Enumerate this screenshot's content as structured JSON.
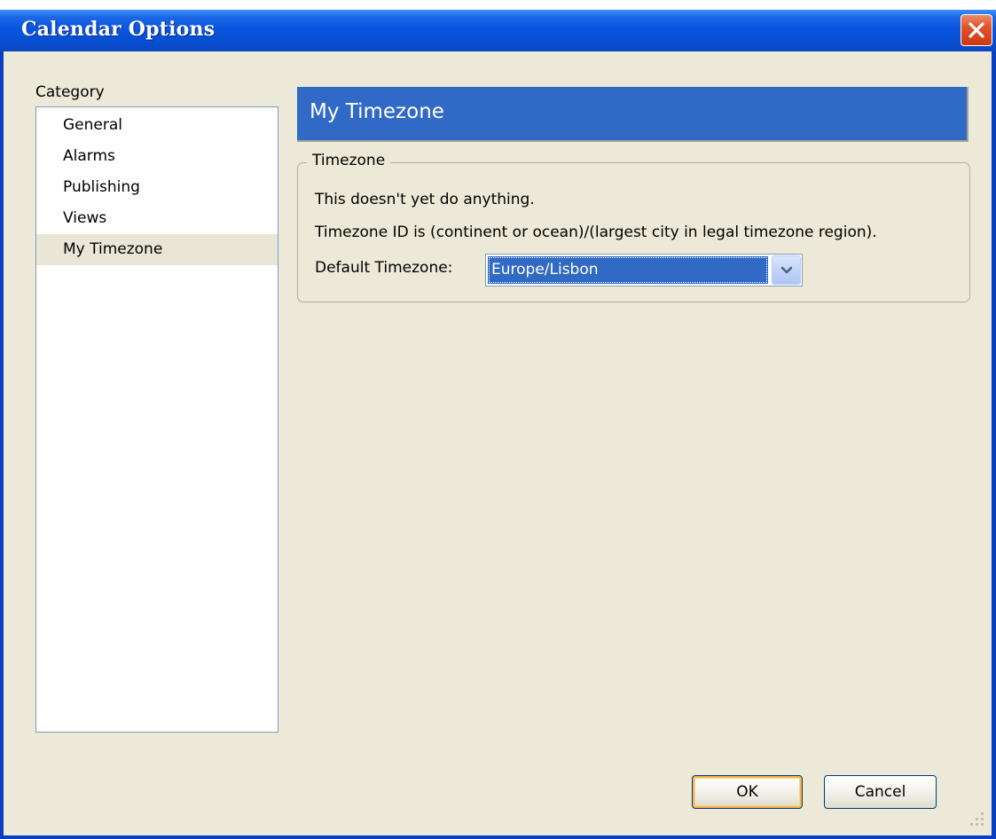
{
  "window": {
    "title": "Calendar Options"
  },
  "sidebar": {
    "label": "Category",
    "items": [
      {
        "label": "General"
      },
      {
        "label": "Alarms"
      },
      {
        "label": "Publishing"
      },
      {
        "label": "Views"
      },
      {
        "label": "My Timezone"
      }
    ],
    "selected": "My Timezone"
  },
  "panel": {
    "title": "My Timezone",
    "group": {
      "legend": "Timezone",
      "line1": "This doesn't yet do anything.",
      "line2": "Timezone ID is (continent or ocean)/(largest city in legal timezone region).",
      "default_label": "Default Timezone:",
      "default_value": "Europe/Lisbon"
    }
  },
  "buttons": {
    "ok": "OK",
    "cancel": "Cancel"
  },
  "icons": {
    "close": "close-icon",
    "dropdown": "chevron-down-icon",
    "resize": "resize-grip-icon"
  },
  "colors": {
    "titlebar": "#0a55e0",
    "header": "#3169c6",
    "selection": "#316ac5",
    "dialog_bg": "#ece9d8"
  }
}
